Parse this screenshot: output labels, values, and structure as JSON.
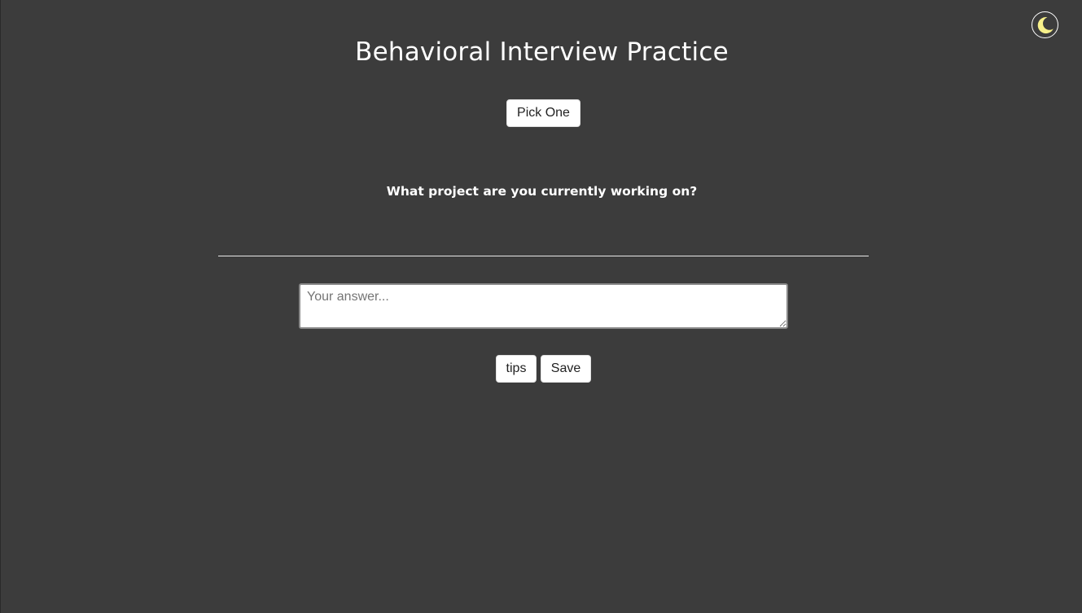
{
  "header": {
    "title": "Behavioral Interview Practice",
    "theme_toggle_icon": "moon-icon",
    "moon_color": "#f7f08a"
  },
  "controls": {
    "pick_label": "Pick One"
  },
  "question": {
    "text": "What project are you currently working on?"
  },
  "answer": {
    "value": "",
    "placeholder": "Your answer..."
  },
  "actions": {
    "tips_label": "tips",
    "save_label": "Save"
  },
  "colors": {
    "background": "#3c3c3c",
    "text": "#ffffff"
  }
}
